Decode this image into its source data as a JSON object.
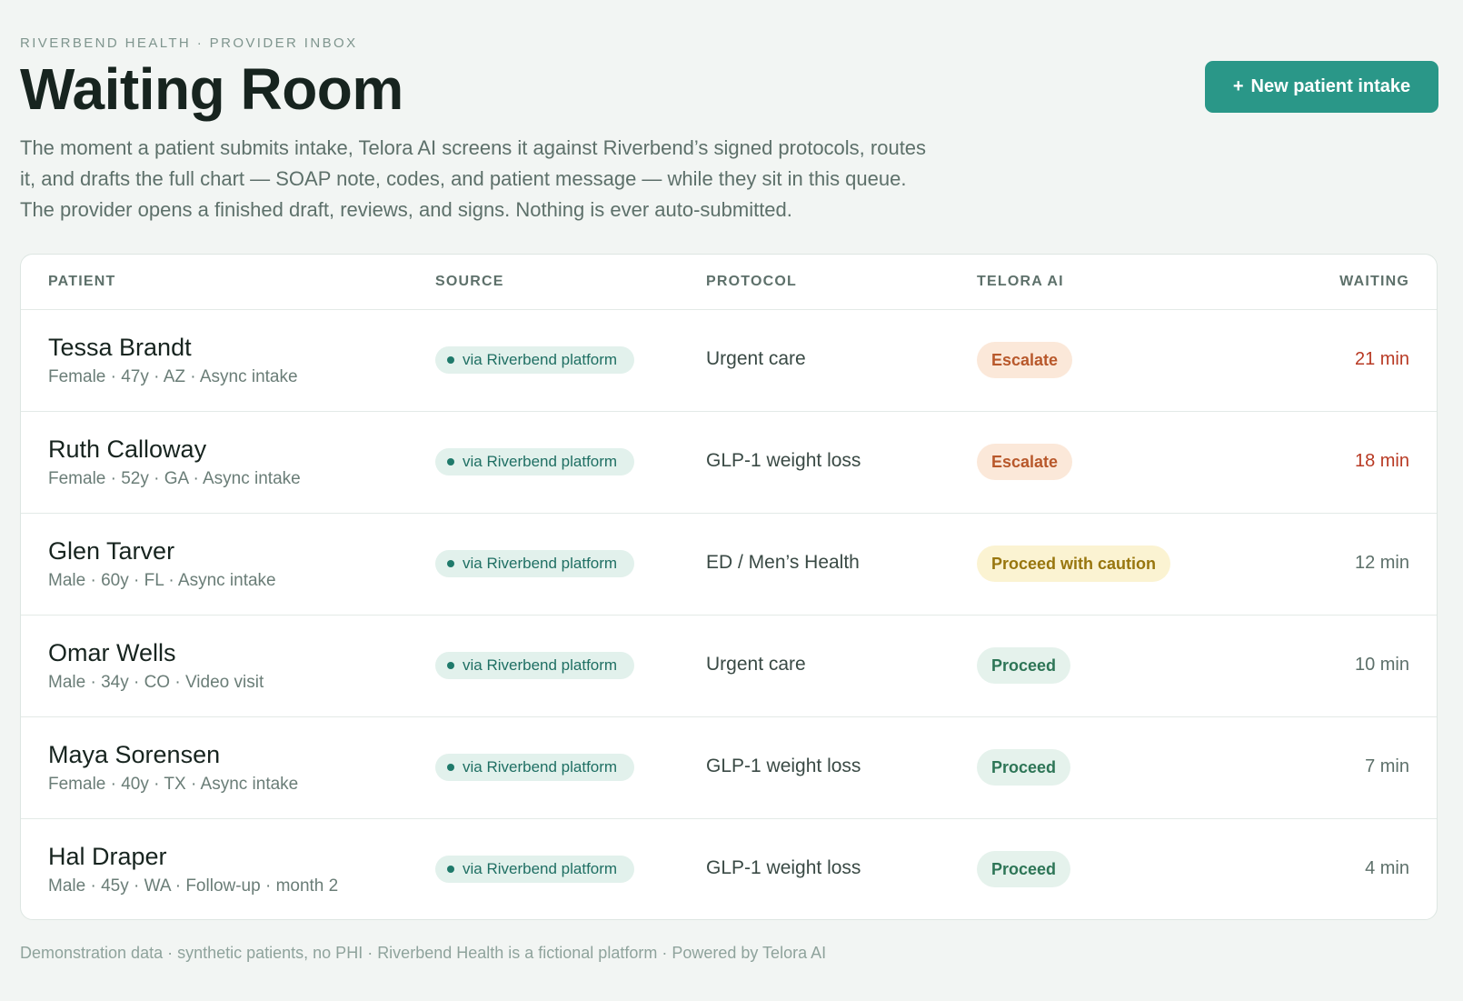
{
  "header": {
    "eyebrow": "RIVERBEND HEALTH · PROVIDER INBOX",
    "title": "Waiting Room",
    "description": "The moment a patient submits intake, Telora AI screens it against Riverbend’s signed protocols, routes it, and drafts the full chart — SOAP note, codes, and patient message — while they sit in this queue. The provider opens a finished draft, reviews, and signs. Nothing is ever auto-submitted.",
    "new_intake_plus": "+",
    "new_intake_label": "New patient intake"
  },
  "table": {
    "columns": {
      "patient": "PATIENT",
      "source": "SOURCE",
      "protocol": "PROTOCOL",
      "ai": "TELORA AI",
      "waiting": "WAITING"
    },
    "rows": [
      {
        "name": "Tessa Brandt",
        "meta": "Female · 47y · AZ · Async intake",
        "source": "via Riverbend platform",
        "protocol": "Urgent care",
        "ai": "Escalate",
        "ai_status": "escalate",
        "waiting": "21 min",
        "urgent": true
      },
      {
        "name": "Ruth Calloway",
        "meta": "Female · 52y · GA · Async intake",
        "source": "via Riverbend platform",
        "protocol": "GLP-1 weight loss",
        "ai": "Escalate",
        "ai_status": "escalate",
        "waiting": "18 min",
        "urgent": true
      },
      {
        "name": "Glen Tarver",
        "meta": "Male · 60y · FL · Async intake",
        "source": "via Riverbend platform",
        "protocol": "ED / Men’s Health",
        "ai": "Proceed with caution",
        "ai_status": "caution",
        "waiting": "12 min",
        "urgent": false
      },
      {
        "name": "Omar Wells",
        "meta": "Male · 34y · CO · Video visit",
        "source": "via Riverbend platform",
        "protocol": "Urgent care",
        "ai": "Proceed",
        "ai_status": "proceed",
        "waiting": "10 min",
        "urgent": false
      },
      {
        "name": "Maya Sorensen",
        "meta": "Female · 40y · TX · Async intake",
        "source": "via Riverbend platform",
        "protocol": "GLP-1 weight loss",
        "ai": "Proceed",
        "ai_status": "proceed",
        "waiting": "7 min",
        "urgent": false
      },
      {
        "name": "Hal Draper",
        "meta": "Male · 45y · WA · Follow-up · month 2",
        "source": "via Riverbend platform",
        "protocol": "GLP-1 weight loss",
        "ai": "Proceed",
        "ai_status": "proceed",
        "waiting": "4 min",
        "urgent": false
      }
    ]
  },
  "colors": {
    "accent": "#2a9788",
    "escalate": "#b8582b",
    "caution": "#98760e",
    "proceed": "#2d7556",
    "urgent_wait": "#b83a24"
  },
  "footer": {
    "text": "Demonstration data · synthetic patients, no PHI · Riverbend Health is a fictional platform · Powered by Telora AI"
  }
}
